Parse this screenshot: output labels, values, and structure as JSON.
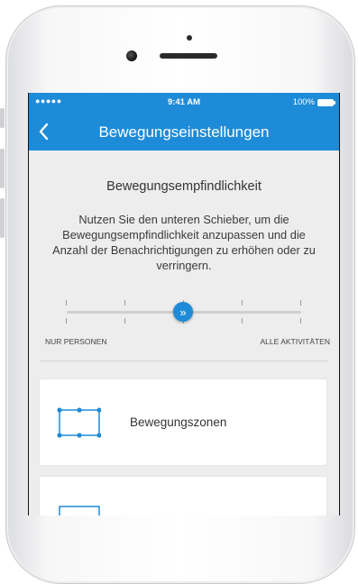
{
  "status_bar": {
    "signal": "●●●●●",
    "time": "9:41 AM",
    "battery": "100%"
  },
  "nav": {
    "title": "Bewegungseinstellungen",
    "back_icon": "chevron-left-icon"
  },
  "section": {
    "title": "Bewegungsempfindlichkeit",
    "description": "Nutzen Sie den unteren Schieber, um die Bewegungsempfindlichkeit anzupassen und die Anzahl der Benachrichtigungen zu erhöhen oder zu verringern."
  },
  "slider": {
    "min_label": "NUR PERSONEN",
    "max_label": "ALLE AKTIVITÄTEN",
    "steps": 5,
    "current_step": 3,
    "thumb_glyph": "»"
  },
  "cards": [
    {
      "label": "Bewegungszonen",
      "icon": "motion-zone-icon"
    },
    {
      "label": "",
      "icon": "motion-zone-icon"
    }
  ],
  "colors": {
    "accent": "#1e8bd8",
    "background": "#ededed",
    "card": "#ffffff"
  }
}
